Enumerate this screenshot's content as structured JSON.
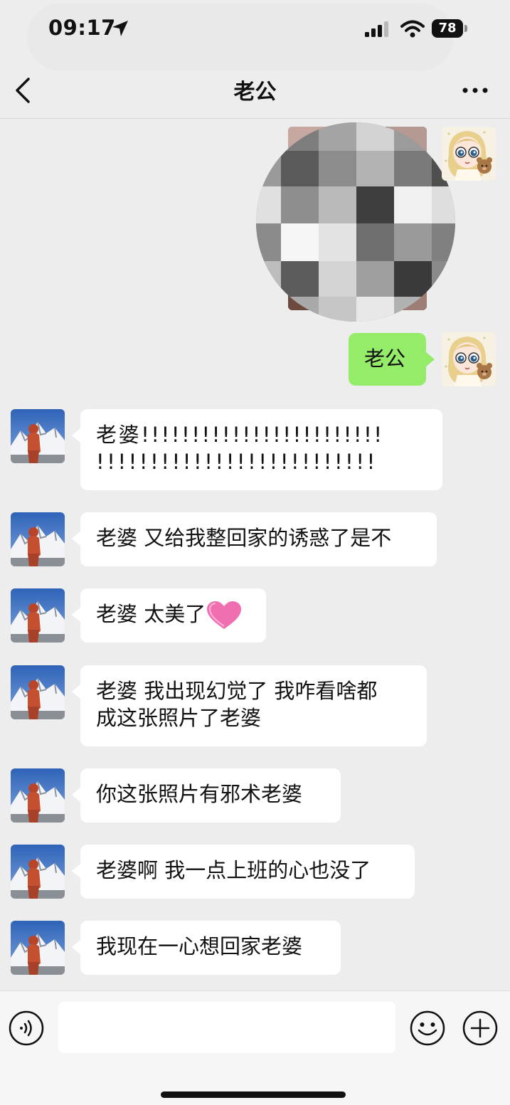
{
  "status_bar": {
    "time": "09:17",
    "battery": "78"
  },
  "nav": {
    "title": "老公"
  },
  "messages": [
    {
      "from": "me",
      "type": "image"
    },
    {
      "from": "me",
      "text": "老公"
    },
    {
      "from": "other",
      "lines": [
        "老婆!!!!!!!!!!!!!!!!!!!!!!!!",
        "!!!!!!!!!!!!!!!!!!!!!!!!!!"
      ]
    },
    {
      "from": "other",
      "text": "老婆 又给我整回家的诱惑了是不"
    },
    {
      "from": "other",
      "text": "老婆 太美了",
      "sticker": "pink-heart"
    },
    {
      "from": "other",
      "lines": [
        "老婆  我出现幻觉了 我咋看啥都",
        "成这张照片了老婆"
      ]
    },
    {
      "from": "other",
      "text": "你这张照片有邪术老婆"
    },
    {
      "from": "other",
      "text": "老婆啊 我一点上班的心也没了"
    },
    {
      "from": "other",
      "text": "我现在一心想回家老婆"
    }
  ],
  "input_bar": {
    "value": "",
    "placeholder": ""
  },
  "colors": {
    "background": "#ededed",
    "my_bubble": "#95ec69",
    "their_bubble": "#ffffff"
  },
  "icons": [
    "location-arrow-icon",
    "signal-icon",
    "wifi-icon",
    "back-icon",
    "more-icon",
    "voice-icon",
    "emoji-icon",
    "plus-icon"
  ]
}
